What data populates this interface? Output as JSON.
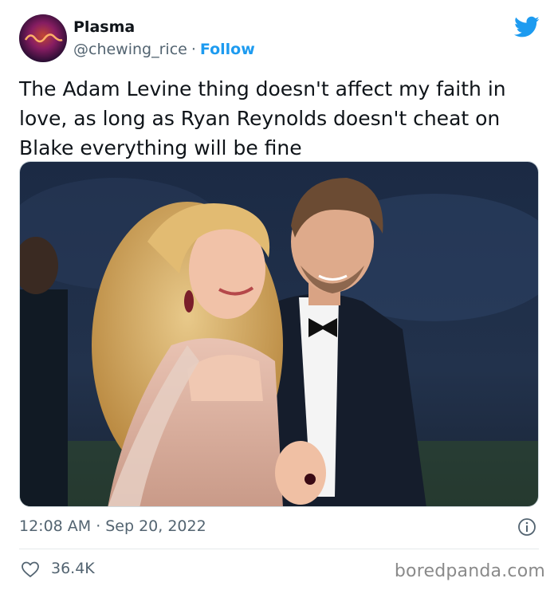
{
  "author": {
    "name": "Plasma",
    "handle": "@chewing_rice",
    "separator": "·",
    "follow_label": "Follow"
  },
  "tweet": {
    "text": "The Adam Levine thing doesn't affect my faith in\nlove, as long as Ryan Reynolds doesn't cheat on\nBlake everything will be fine"
  },
  "meta": {
    "time": "12:08 AM",
    "separator": "·",
    "date": "Sep 20, 2022"
  },
  "engagement": {
    "likes": "36.4K"
  },
  "watermark": "boredpanda.com",
  "icons": {
    "brand": "twitter-bird-icon",
    "info": "info-icon",
    "like": "heart-icon"
  },
  "colors": {
    "accent": "#1d9bf0",
    "secondary_text": "#536471",
    "primary_text": "#0f1419"
  }
}
